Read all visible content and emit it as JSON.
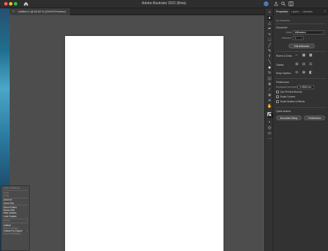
{
  "window": {
    "title": "Adobe Illustrator 2022 (Beta)"
  },
  "document_tab": {
    "label": "Untitled-1 @ 83.62 % (CMYK/Preview)"
  },
  "context_menu": {
    "items": [
      {
        "label": "Undo Fill/Stroke",
        "disabled": true
      },
      {
        "sep": true
      },
      {
        "label": "Undo",
        "disabled": true
      },
      {
        "label": "Redo",
        "disabled": true
      },
      {
        "sep": true
      },
      {
        "label": "Zoom In",
        "disabled": false
      },
      {
        "label": "Zoom Out",
        "disabled": false
      },
      {
        "sep": true
      },
      {
        "label": "Show Rulers",
        "disabled": false
      },
      {
        "label": "Show Grid",
        "disabled": false
      },
      {
        "label": "Hide Guides",
        "disabled": false
      },
      {
        "label": "Lock Guides",
        "disabled": false
      },
      {
        "sep": true
      },
      {
        "label": "Select",
        "disabled": true,
        "submenu": true
      },
      {
        "sep": true
      },
      {
        "label": "Outline",
        "disabled": false
      },
      {
        "label": "Add to Library",
        "disabled": true
      },
      {
        "label": "Collect For Export",
        "disabled": false,
        "submenu": true
      },
      {
        "label": "Export Selection...",
        "disabled": true
      }
    ]
  },
  "panel": {
    "tabs": [
      "Properties",
      "Layers",
      "Libraries"
    ],
    "active_tab": "Properties",
    "no_selection": "No Selection",
    "document_heading": "Document",
    "units_label": "Units:",
    "units_value": "Millimeters",
    "artboard_label": "Artboard:",
    "artboard_value": "1",
    "edit_artboards": "Edit Artboards",
    "rulers_grids": "Rulers & Grids",
    "guides": "Guides",
    "snap_options": "Snap Options",
    "preferences": "Preferences",
    "keyboard_increment_label": "Keyboard Increment:",
    "keyboard_increment_value": "0.3528 mm",
    "use_preview_bounds": "Use Preview Bounds",
    "scale_corners": "Scale Corners",
    "scale_strokes_effects": "Scale Strokes & Effects",
    "quick_actions": "Quick Actions",
    "document_setup": "Document Setup",
    "preferences_button": "Preferences"
  },
  "colors": {
    "accent": "#4a78c2",
    "canvas": "#4d4d4d",
    "panel": "#323232",
    "artboard": "#ffffff"
  }
}
